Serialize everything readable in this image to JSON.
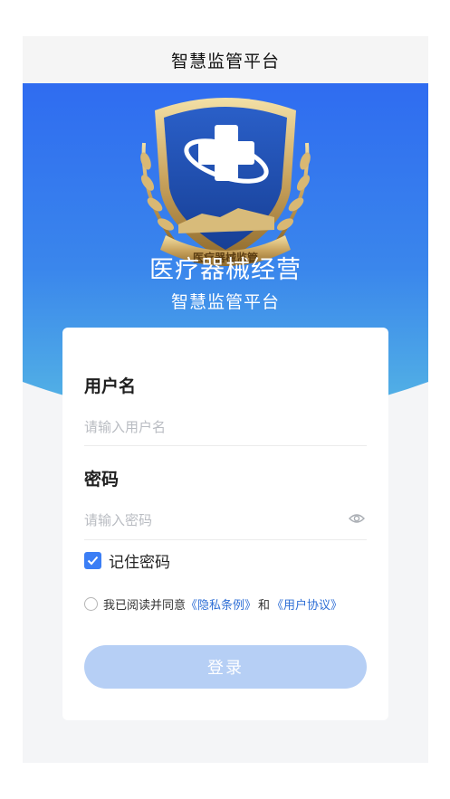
{
  "navbar": {
    "title": "智慧监管平台"
  },
  "brand": {
    "emblem_text": "医疗器械监管",
    "title": "医疗器械经营",
    "subtitle": "智慧监管平台"
  },
  "login": {
    "username_label": "用户名",
    "username_placeholder": "请输入用户名",
    "password_label": "密码",
    "password_placeholder": "请输入密码",
    "remember_label": "记住密码",
    "remember_checked": true,
    "agree_prefix": "我已阅读并同意",
    "privacy_link": "《隐私条例》",
    "agree_and": "和",
    "user_agreement_link": "《用户协议》",
    "agree_checked": false,
    "submit_label": "登录"
  },
  "colors": {
    "banner_top": "#2f6cf0",
    "banner_bottom": "#4fb0e6",
    "accent": "#3b7ef5",
    "link": "#2f6fd6",
    "button_disabled": "#b6cff5",
    "emblem_gold": "#c9a35d",
    "emblem_blue": "#1f4fb5"
  },
  "icons": {
    "eye": "eye-icon",
    "check": "check-icon",
    "emblem": "shield-cross-emblem"
  }
}
